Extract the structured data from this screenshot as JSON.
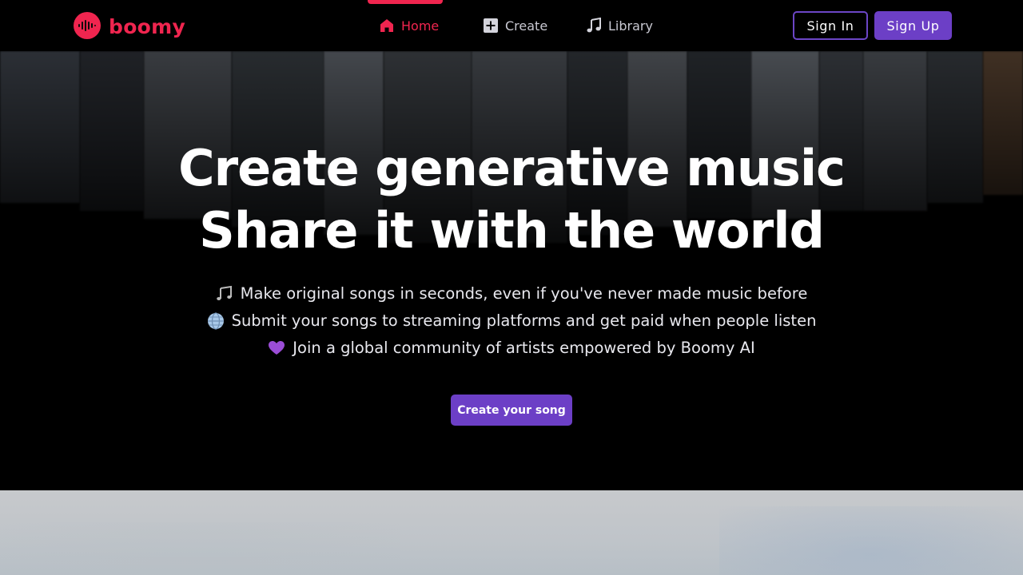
{
  "brand": {
    "name": "boomy",
    "color": "#f0254f"
  },
  "nav": {
    "items": [
      {
        "label": "Home",
        "icon": "home-icon",
        "active": true
      },
      {
        "label": "Create",
        "icon": "plus-square-icon",
        "active": false
      },
      {
        "label": "Library",
        "icon": "music-note-icon",
        "active": false
      }
    ]
  },
  "auth": {
    "sign_in": "Sign In",
    "sign_up": "Sign Up"
  },
  "hero": {
    "title_line1": "Create generative music",
    "title_line2": "Share it with the world",
    "features": [
      {
        "icon": "notes-emoji-icon",
        "text": "Make original songs in seconds, even if you've never made music before"
      },
      {
        "icon": "globe-emoji-icon",
        "text": "Submit your songs to streaming platforms and get paid when people listen"
      },
      {
        "icon": "purple-heart-emoji-icon",
        "text": "Join a global community of artists empowered by Boomy AI"
      }
    ],
    "cta": "Create your song"
  },
  "colors": {
    "accent": "#6c3fc6",
    "brand": "#f0254f",
    "background": "#000000"
  }
}
